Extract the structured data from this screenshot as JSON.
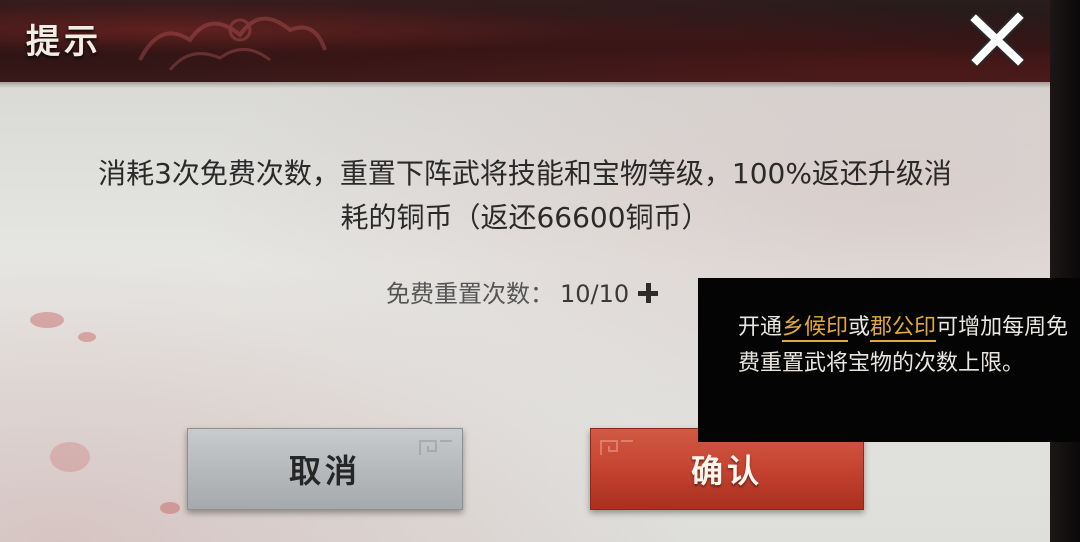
{
  "dialog": {
    "title": "提示",
    "close_icon": "close-icon"
  },
  "message": {
    "line1": "消耗3次免费次数，重置下阵武将技能和宝物等级，100%返还升级消",
    "line2": "耗的铜币（返还66600铜币）"
  },
  "reset": {
    "label": "免费重置次数：",
    "count": "10/10",
    "add_icon": "plus-icon"
  },
  "buttons": {
    "cancel_label": "取消",
    "confirm_label": "确认"
  },
  "tooltip": {
    "prefix": "开通",
    "link1": "乡候印",
    "middle": "或",
    "link2": "郡公印",
    "suffix": "可增加每周免费重置武将宝物的次数上限。",
    "highlight_color": "#e0a83c"
  },
  "colors": {
    "confirm_red": "#c2412f",
    "cancel_gray": "#b4b8bb",
    "body_bg": "#e3e3e0"
  }
}
